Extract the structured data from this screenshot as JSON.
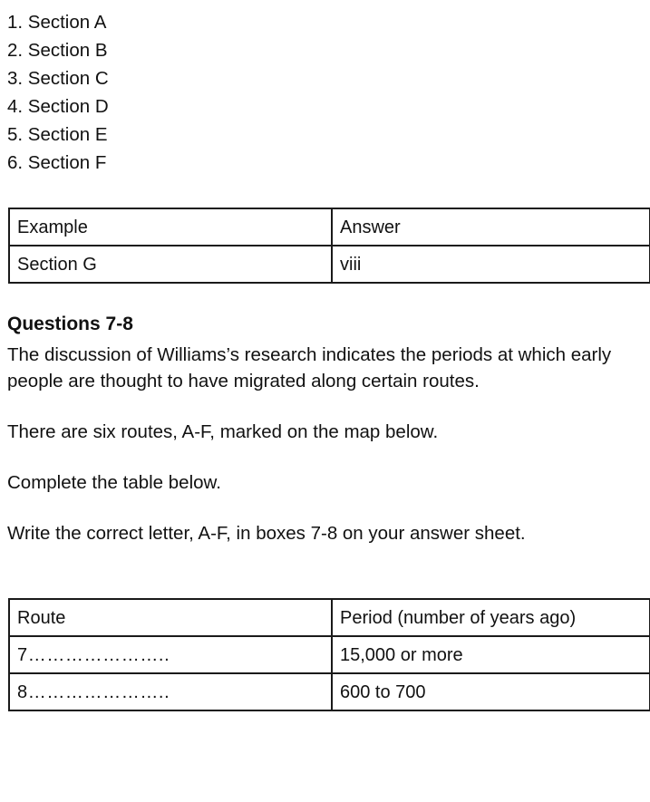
{
  "section_list": [
    "1. Section A",
    "2. Section B",
    "3. Section C",
    "4. Section D",
    "5. Section E",
    "6. Section F"
  ],
  "example_table": {
    "header": {
      "left": "Example",
      "right": "Answer"
    },
    "rows": [
      {
        "left": "Section G",
        "right": "viii"
      }
    ]
  },
  "questions": {
    "heading": "Questions 7-8",
    "paragraphs": [
      "The discussion of Williams’s research indicates the periods at which early people are thought to have migrated along certain routes.",
      "There are six routes, A-F, marked on the map below.",
      "Complete the table below.",
      "Write the correct letter, A-F, in boxes 7-8 on your answer sheet."
    ]
  },
  "answer_table": {
    "header": {
      "left": "Route",
      "right": "Period (number of years ago)"
    },
    "rows": [
      {
        "left": "7…………………..",
        "right": "15,000 or more"
      },
      {
        "left": "8…………………..",
        "right": "600 to 700"
      }
    ]
  }
}
